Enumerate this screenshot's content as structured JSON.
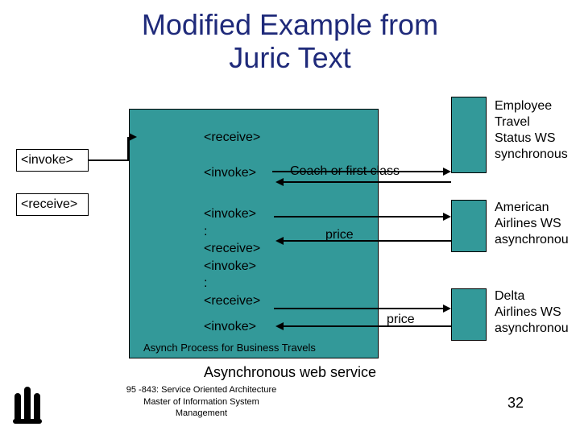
{
  "title_line1": "Modified Example from",
  "title_line2": "Juric Text",
  "left_invoke": "<invoke>",
  "left_receive": "<receive>",
  "center": {
    "receive_top": "<receive>",
    "invoke_top": "<invoke>",
    "block": "<invoke>\n:\n<receive>\n<invoke>\n:\n<receive>",
    "invoke_bottom": "<invoke>",
    "asynch_caption": "Asynch Process for Business Travels"
  },
  "edge_labels": {
    "coach": "Coach or first class",
    "price1": "price",
    "price2": "price"
  },
  "right": {
    "employee": "Employee\nTravel\nStatus WS\nsynchronous",
    "american": "American\nAirlines WS\nasynchronou",
    "delta": "Delta\nAirlines WS\nasynchronou"
  },
  "footer": {
    "async_ws": "Asynchronous web service",
    "course": "95 -843: Service Oriented Architecture",
    "master": "Master of Information System\nManagement"
  },
  "page_number": "32"
}
